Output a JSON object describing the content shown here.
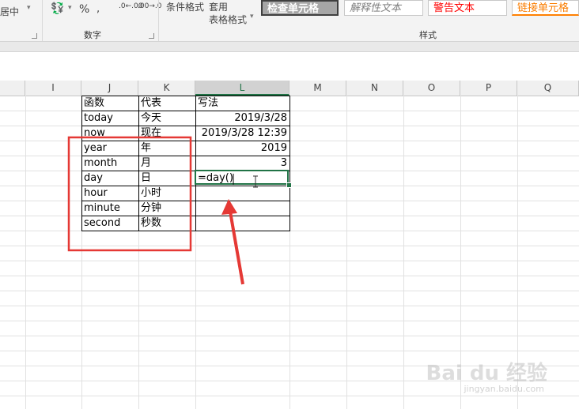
{
  "ribbon": {
    "merge_center_label": "居中",
    "number_group_label": "数字",
    "percent_symbol": "%",
    "decimal_increase": ".0←.00",
    "decimal_decrease": ".00→.0",
    "conditional_format_label": "条件格式",
    "format_as_table_line1": "套用",
    "format_as_table_line2": "表格格式",
    "styles_group_label": "样式",
    "style_check_cell": "检查单元格",
    "style_explanatory": "解释性文本",
    "style_warning": "警告文本",
    "style_linked_cell": "链接单元格"
  },
  "columns": [
    "I",
    "J",
    "K",
    "L",
    "M",
    "N",
    "O",
    "P",
    "Q"
  ],
  "selected_column": "L",
  "table": {
    "header": {
      "func": "函数",
      "desc": "代表",
      "syntax": "写法"
    },
    "rows": [
      {
        "func": "today",
        "desc": "今天",
        "syntax": "2019/3/28"
      },
      {
        "func": "now",
        "desc": "现在",
        "syntax": "2019/3/28 12:39"
      },
      {
        "func": "year",
        "desc": "年",
        "syntax": "2019"
      },
      {
        "func": "month",
        "desc": "月",
        "syntax": "3"
      },
      {
        "func": "day",
        "desc": "日",
        "syntax": "=day()"
      },
      {
        "func": "hour",
        "desc": "小时",
        "syntax": ""
      },
      {
        "func": "minute",
        "desc": "分钟",
        "syntax": ""
      },
      {
        "func": "second",
        "desc": "秒数",
        "syntax": ""
      }
    ]
  },
  "colors": {
    "annotation_red": "#e53935",
    "excel_green": "#217346"
  },
  "watermark": {
    "brand": "Bai du 经验",
    "url": "jingyan.baidu.com"
  }
}
